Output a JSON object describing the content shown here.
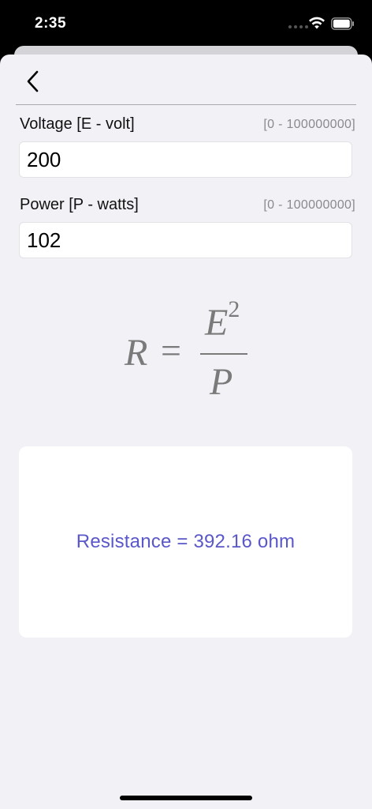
{
  "status_bar": {
    "time": "2:35",
    "icons": [
      "signal-dots-icon",
      "wifi-icon",
      "battery-icon"
    ]
  },
  "nav": {
    "back_icon": "chevron-left-icon"
  },
  "fields": [
    {
      "label": "Voltage [E - volt]",
      "range": "[0 - 100000000]",
      "value": "200"
    },
    {
      "label": "Power [P - watts]",
      "range": "[0 - 100000000]",
      "value": "102"
    }
  ],
  "formula": {
    "lhs": "R",
    "equals": "=",
    "numerator": "E",
    "exponent": "2",
    "denominator": "P"
  },
  "result": {
    "text": "Resistance = 392.16 ohm",
    "color": "#5a57c9"
  },
  "colors": {
    "sheet_background": "#f2f1f6",
    "card_background": "#ffffff",
    "formula": "#7a7a7a"
  }
}
